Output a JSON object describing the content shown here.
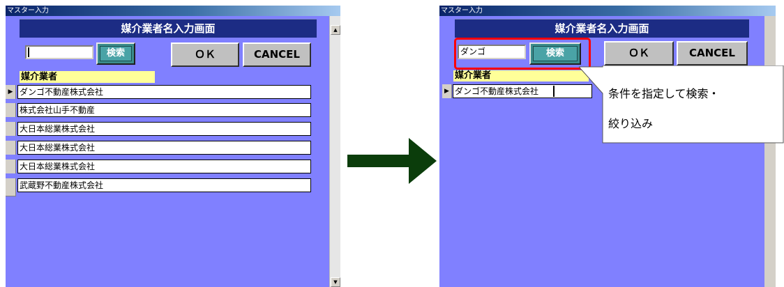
{
  "left": {
    "titlebar": "マスター入力",
    "header": "媒介業者名入力画面",
    "search_input": "",
    "search_button": "検索",
    "ok_button": "ＯＫ",
    "cancel_button": "CANCEL",
    "field_label": "媒介業者",
    "rows": [
      "ダンゴ不動産株式会社",
      "株式会社山手不動産",
      "大日本総業株式会社",
      "大日本総業株式会社",
      "大日本総業株式会社",
      "武蔵野不動産株式会社"
    ],
    "scroll_up": "▲",
    "scroll_down": "▼"
  },
  "right": {
    "titlebar": "マスター入力",
    "header": "媒介業者名入力画面",
    "search_input": "ダンゴ",
    "search_button": "検索",
    "ok_button": "ＯＫ",
    "cancel_button": "CANCEL",
    "field_label": "媒介業者",
    "rows": [
      "ダンゴ不動産株式会社"
    ]
  },
  "row_selector_glyph": "▶",
  "callout": {
    "line1": "条件を指定して検索・",
    "line2": "絞り込み"
  },
  "colors": {
    "form_bg": "#8080ff",
    "header_bg": "#1c2c84",
    "label_bg": "#ffff99",
    "search_button": "#4aa3a6",
    "arrow": "#0b3d0b",
    "highlight": "#ff0000"
  }
}
